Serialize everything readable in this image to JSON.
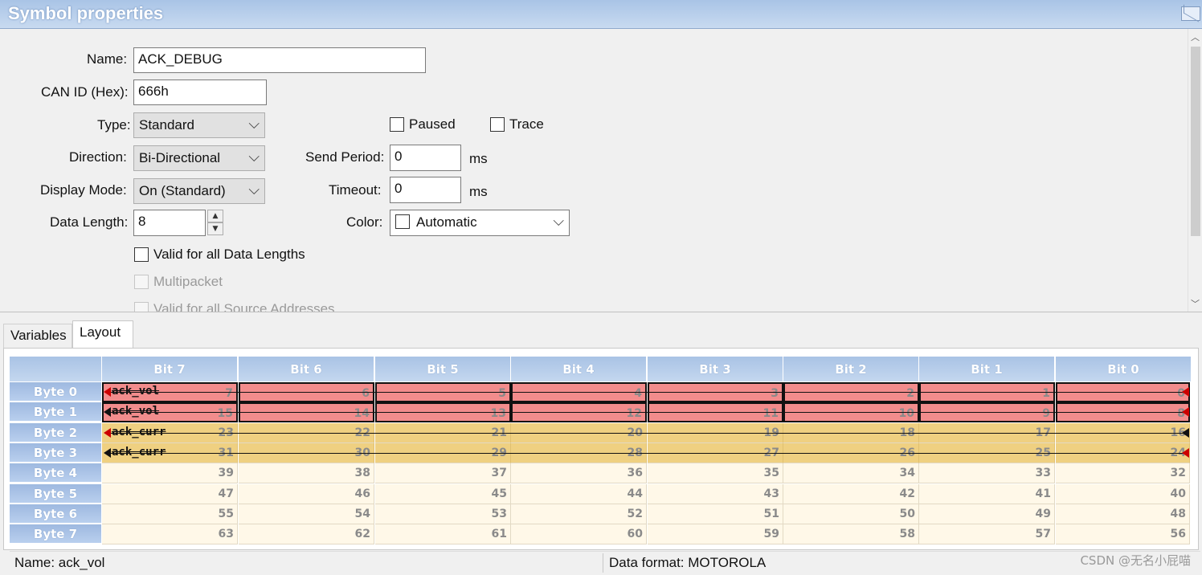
{
  "window": {
    "title": "Symbol properties"
  },
  "form": {
    "name_label": "Name:",
    "name_value": "ACK_DEBUG",
    "canid_label": "CAN ID (Hex):",
    "canid_value": "666h",
    "type_label": "Type:",
    "type_value": "Standard",
    "direction_label": "Direction:",
    "direction_value": "Bi-Directional",
    "display_label": "Display Mode:",
    "display_value": "On (Standard)",
    "datalen_label": "Data Length:",
    "datalen_value": "8",
    "paused_label": "Paused",
    "trace_label": "Trace",
    "sendperiod_label": "Send Period:",
    "sendperiod_value": "0",
    "sendperiod_unit": "ms",
    "timeout_label": "Timeout:",
    "timeout_value": "0",
    "timeout_unit": "ms",
    "color_label": "Color:",
    "color_value": "Automatic",
    "valid_all_lengths": "Valid for all Data Lengths",
    "multipacket": "Multipacket",
    "valid_all_sources": "Valid for all Source Addresses"
  },
  "tabs": [
    {
      "label": "Variables"
    },
    {
      "label": "Layout"
    }
  ],
  "layout": {
    "bit_headers": [
      "Bit 7",
      "Bit 6",
      "Bit 5",
      "Bit 4",
      "Bit 3",
      "Bit 2",
      "Bit 1",
      "Bit 0"
    ],
    "byte_headers": [
      "Byte 0",
      "Byte 1",
      "Byte 2",
      "Byte 3",
      "Byte 4",
      "Byte 5",
      "Byte 6",
      "Byte 7"
    ],
    "bit_numbers": [
      [
        "7",
        "6",
        "5",
        "4",
        "3",
        "2",
        "1",
        "0"
      ],
      [
        "15",
        "14",
        "13",
        "12",
        "11",
        "10",
        "9",
        "8"
      ],
      [
        "23",
        "22",
        "21",
        "20",
        "19",
        "18",
        "17",
        "16"
      ],
      [
        "31",
        "30",
        "29",
        "28",
        "27",
        "26",
        "25",
        "24"
      ],
      [
        "39",
        "38",
        "37",
        "36",
        "35",
        "34",
        "33",
        "32"
      ],
      [
        "47",
        "46",
        "45",
        "44",
        "43",
        "42",
        "41",
        "40"
      ],
      [
        "55",
        "54",
        "53",
        "52",
        "51",
        "50",
        "49",
        "48"
      ],
      [
        "63",
        "62",
        "61",
        "60",
        "59",
        "58",
        "57",
        "56"
      ]
    ],
    "signals": [
      {
        "label": "ack_vol",
        "color": "#f28c8c"
      },
      {
        "label": "ack_vol",
        "color": "#f28c8c"
      },
      {
        "label": "ack_curr",
        "color": "#efd081"
      },
      {
        "label": "ack_curr",
        "color": "#efd081"
      }
    ]
  },
  "status": {
    "name": "Name: ack_vol",
    "format": "Data format: MOTOROLA"
  },
  "watermark": "CSDN @无名小屁喵"
}
